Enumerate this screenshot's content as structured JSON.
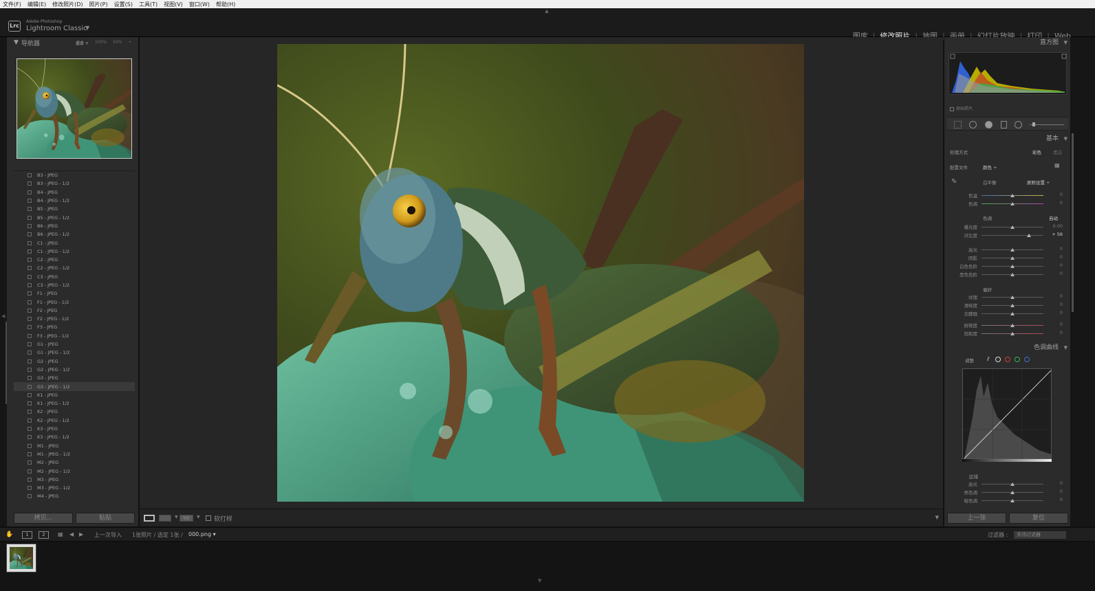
{
  "menu": [
    "文件(F)",
    "编辑(E)",
    "修改照片(D)",
    "照片(P)",
    "设置(S)",
    "工具(T)",
    "视图(V)",
    "窗口(W)",
    "帮助(H)"
  ],
  "app": {
    "logo": "Lrc",
    "vendor": "Adobe Photoshop",
    "name": "Lightroom Classic",
    "caret": "▼"
  },
  "modules": [
    {
      "label": "图库",
      "active": false
    },
    {
      "label": "修改照片",
      "active": true
    },
    {
      "label": "地图",
      "active": false
    },
    {
      "label": "画册",
      "active": false
    },
    {
      "label": "幻灯片放映",
      "active": false
    },
    {
      "label": "打印",
      "active": false
    },
    {
      "label": "Web",
      "active": false
    }
  ],
  "navigator": {
    "title": "导航器",
    "zoom_options": [
      "适合 ÷",
      "100%",
      "50%",
      "÷"
    ],
    "active_zoom": 0
  },
  "presets": {
    "items": [
      "B3 - JPEG",
      "B3 - JPEG - 1/2",
      "B4 - JPEG",
      "B4 - JPEG - 1/2",
      "B5 - JPEG",
      "B5 - JPEG - 1/2",
      "B6 - JPEG",
      "B6 - JPEG - 1/2",
      "C1 - JPEG",
      "C1 - JPEG - 1/2",
      "C2 - JPEG",
      "C2 - JPEG - 1/2",
      "C3 - JPEG",
      "C3 - JPEG - 1/2",
      "F1 - JPEG",
      "F1 - JPEG - 1/2",
      "F2 - JPEG",
      "F2 - JPEG - 1/2",
      "F3 - JPEG",
      "F3 - JPEG - 1/2",
      "G1 - JPEG",
      "G1 - JPEG - 1/2",
      "G2 - JPEG",
      "G2 - JPEG - 1/2",
      "G3 - JPEG",
      "G3 - JPEG - 1/2",
      "K1 - JPEG",
      "K1 - JPEG - 1/2",
      "K2 - JPEG",
      "K2 - JPEG - 1/2",
      "K3 - JPEG",
      "K3 - JPEG - 1/2",
      "M1 - JPEG",
      "M1 - JPEG - 1/2",
      "M2 - JPEG",
      "M2 - JPEG - 1/2",
      "M3 - JPEG",
      "M3 - JPEG - 1/2",
      "M4 - JPEG"
    ],
    "selected_index": 25,
    "copy_label": "拷贝...",
    "paste_label": "粘贴"
  },
  "toolbar": {
    "survey_label": "Y|Y",
    "soft_proof_label": "软打样",
    "menu_caret": "▼"
  },
  "histogram": {
    "title": "直方图",
    "original_photo_label": "原始照片"
  },
  "basic": {
    "title": "基本",
    "treatment_label": "处理方式",
    "treatment_color": "彩色",
    "treatment_bw": "黑白",
    "profile_label": "配置文件",
    "profile_value": "颜色 ÷",
    "wb_label": "白平衡",
    "wb_value": "原照设置 ÷",
    "temp_label": "色温",
    "tint_label": "色调",
    "tone_title": "色调",
    "auto_label": "自动",
    "exposure_label": "曝光度",
    "exposure_value": "0.00",
    "contrast_label": "对比度",
    "contrast_value": "+ 56",
    "highlights_label": "高光",
    "shadows_label": "阴影",
    "whites_label": "白色色阶",
    "blacks_label": "黑色色阶",
    "presence_title": "偏好",
    "texture_label": "纹理",
    "clarity_label": "清晰度",
    "dehaze_label": "去朦胧",
    "vibrance_label": "鲜艳度",
    "saturation_label": "饱和度",
    "zero": "0"
  },
  "tone_curve": {
    "title": "色调曲线",
    "adjust_label": "调整",
    "region_label": "区域",
    "highlights_label": "高光",
    "lights_label": "亮色调",
    "darks_label": "暗色调",
    "zero": "0"
  },
  "right_buttons": {
    "previous": "上一张",
    "reset": "复位"
  },
  "filmstrip_bar": {
    "screen1": "1",
    "screen2": "2",
    "source": "上一次导入",
    "info": "1张照片 / 选定 1张 /",
    "filename": "000.png ▾",
    "filter_label": "过滤器 :",
    "filter_value": "关闭过滤器"
  },
  "colors": {
    "accent_active_module": "#e6e6e6",
    "panel_bg": "#2b2b2b",
    "main_bg": "#262626"
  },
  "icons": [
    "lock-icon",
    "grid-icon",
    "prev-arrow-icon",
    "next-arrow-icon",
    "crop-icon",
    "spot-removal-icon",
    "redeye-icon",
    "graduated-filter-icon",
    "radial-filter-icon",
    "adjustment-brush-icon",
    "eyedropper-icon",
    "point-curve-icon"
  ]
}
